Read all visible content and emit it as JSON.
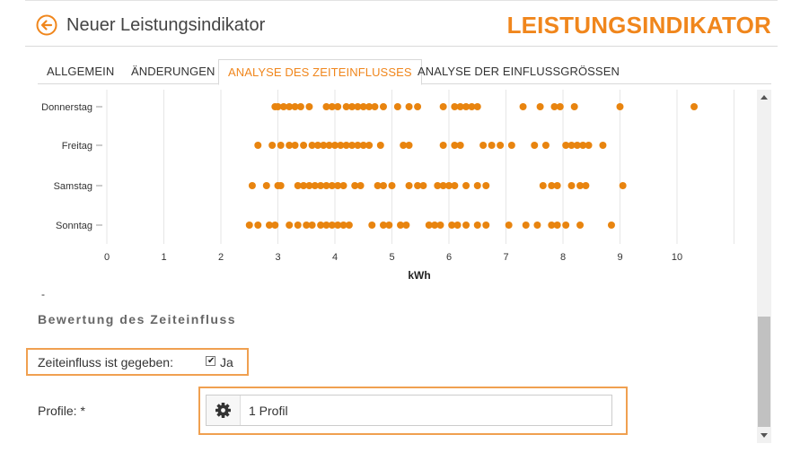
{
  "header": {
    "title": "Neuer Leistungsindikator",
    "brand": "LEISTUNGSINDIKATOR"
  },
  "tabs": [
    {
      "label": "ALLGEMEIN",
      "active": false
    },
    {
      "label": "ÄNDERUNGEN",
      "active": false
    },
    {
      "label": "ANALYSE DES ZEITEINFLUSSES",
      "active": true
    },
    {
      "label": "ANALYSE DER EINFLUSSGRÖSSEN",
      "active": false
    }
  ],
  "chart_data": {
    "type": "scatter",
    "xlabel": "kWh",
    "xlim": [
      0,
      11
    ],
    "xticks": [
      0,
      1,
      2,
      3,
      4,
      5,
      6,
      7,
      8,
      9,
      10
    ],
    "color": "#e8840f",
    "grid": true,
    "categories": [
      "Donnerstag",
      "Freitag",
      "Samstag",
      "Sonntag"
    ],
    "points": [
      [
        2.95,
        3.0,
        3.1,
        3.2,
        3.3,
        3.4,
        3.55,
        3.85,
        3.95,
        4.05,
        4.2,
        4.3,
        4.4,
        4.5,
        4.6,
        4.7,
        4.85,
        5.1,
        5.3,
        5.45,
        5.9,
        6.1,
        6.2,
        6.3,
        6.4,
        6.5,
        7.3,
        7.6,
        7.85,
        7.95,
        8.2,
        9.0,
        10.3
      ],
      [
        2.65,
        2.9,
        3.05,
        3.2,
        3.3,
        3.45,
        3.6,
        3.7,
        3.8,
        3.9,
        4.0,
        4.1,
        4.2,
        4.3,
        4.4,
        4.5,
        4.6,
        4.8,
        5.2,
        5.3,
        5.9,
        6.1,
        6.2,
        6.6,
        6.75,
        6.9,
        7.1,
        7.5,
        7.7,
        8.05,
        8.15,
        8.25,
        8.35,
        8.45,
        8.7
      ],
      [
        2.55,
        2.8,
        3.0,
        3.05,
        3.35,
        3.45,
        3.55,
        3.65,
        3.75,
        3.85,
        3.95,
        4.05,
        4.15,
        4.35,
        4.45,
        4.75,
        4.85,
        5.0,
        5.3,
        5.45,
        5.55,
        5.8,
        5.9,
        6.0,
        6.1,
        6.3,
        6.5,
        6.65,
        7.65,
        7.8,
        7.9,
        8.15,
        8.3,
        8.4,
        9.05
      ],
      [
        2.5,
        2.65,
        2.85,
        2.95,
        3.2,
        3.35,
        3.5,
        3.6,
        3.75,
        3.85,
        3.95,
        4.05,
        4.15,
        4.25,
        4.65,
        4.85,
        4.95,
        5.15,
        5.25,
        5.65,
        5.75,
        5.85,
        6.05,
        6.15,
        6.3,
        6.5,
        6.65,
        7.05,
        7.35,
        7.55,
        7.8,
        7.9,
        8.05,
        8.3,
        8.85
      ]
    ]
  },
  "dash": "-",
  "section_title": "Bewertung des Zeiteinfluss",
  "form": {
    "zeit_label": "Zeiteinfluss ist gegeben:",
    "checkbox_label": "Ja",
    "checkbox_checked": true,
    "profile_label": "Profile: *",
    "profile_value": "1 Profil"
  },
  "icons": {
    "back": "arrow-left-circle-icon",
    "profile_button": "gear-icon"
  },
  "colors": {
    "accent": "#f0861c"
  }
}
